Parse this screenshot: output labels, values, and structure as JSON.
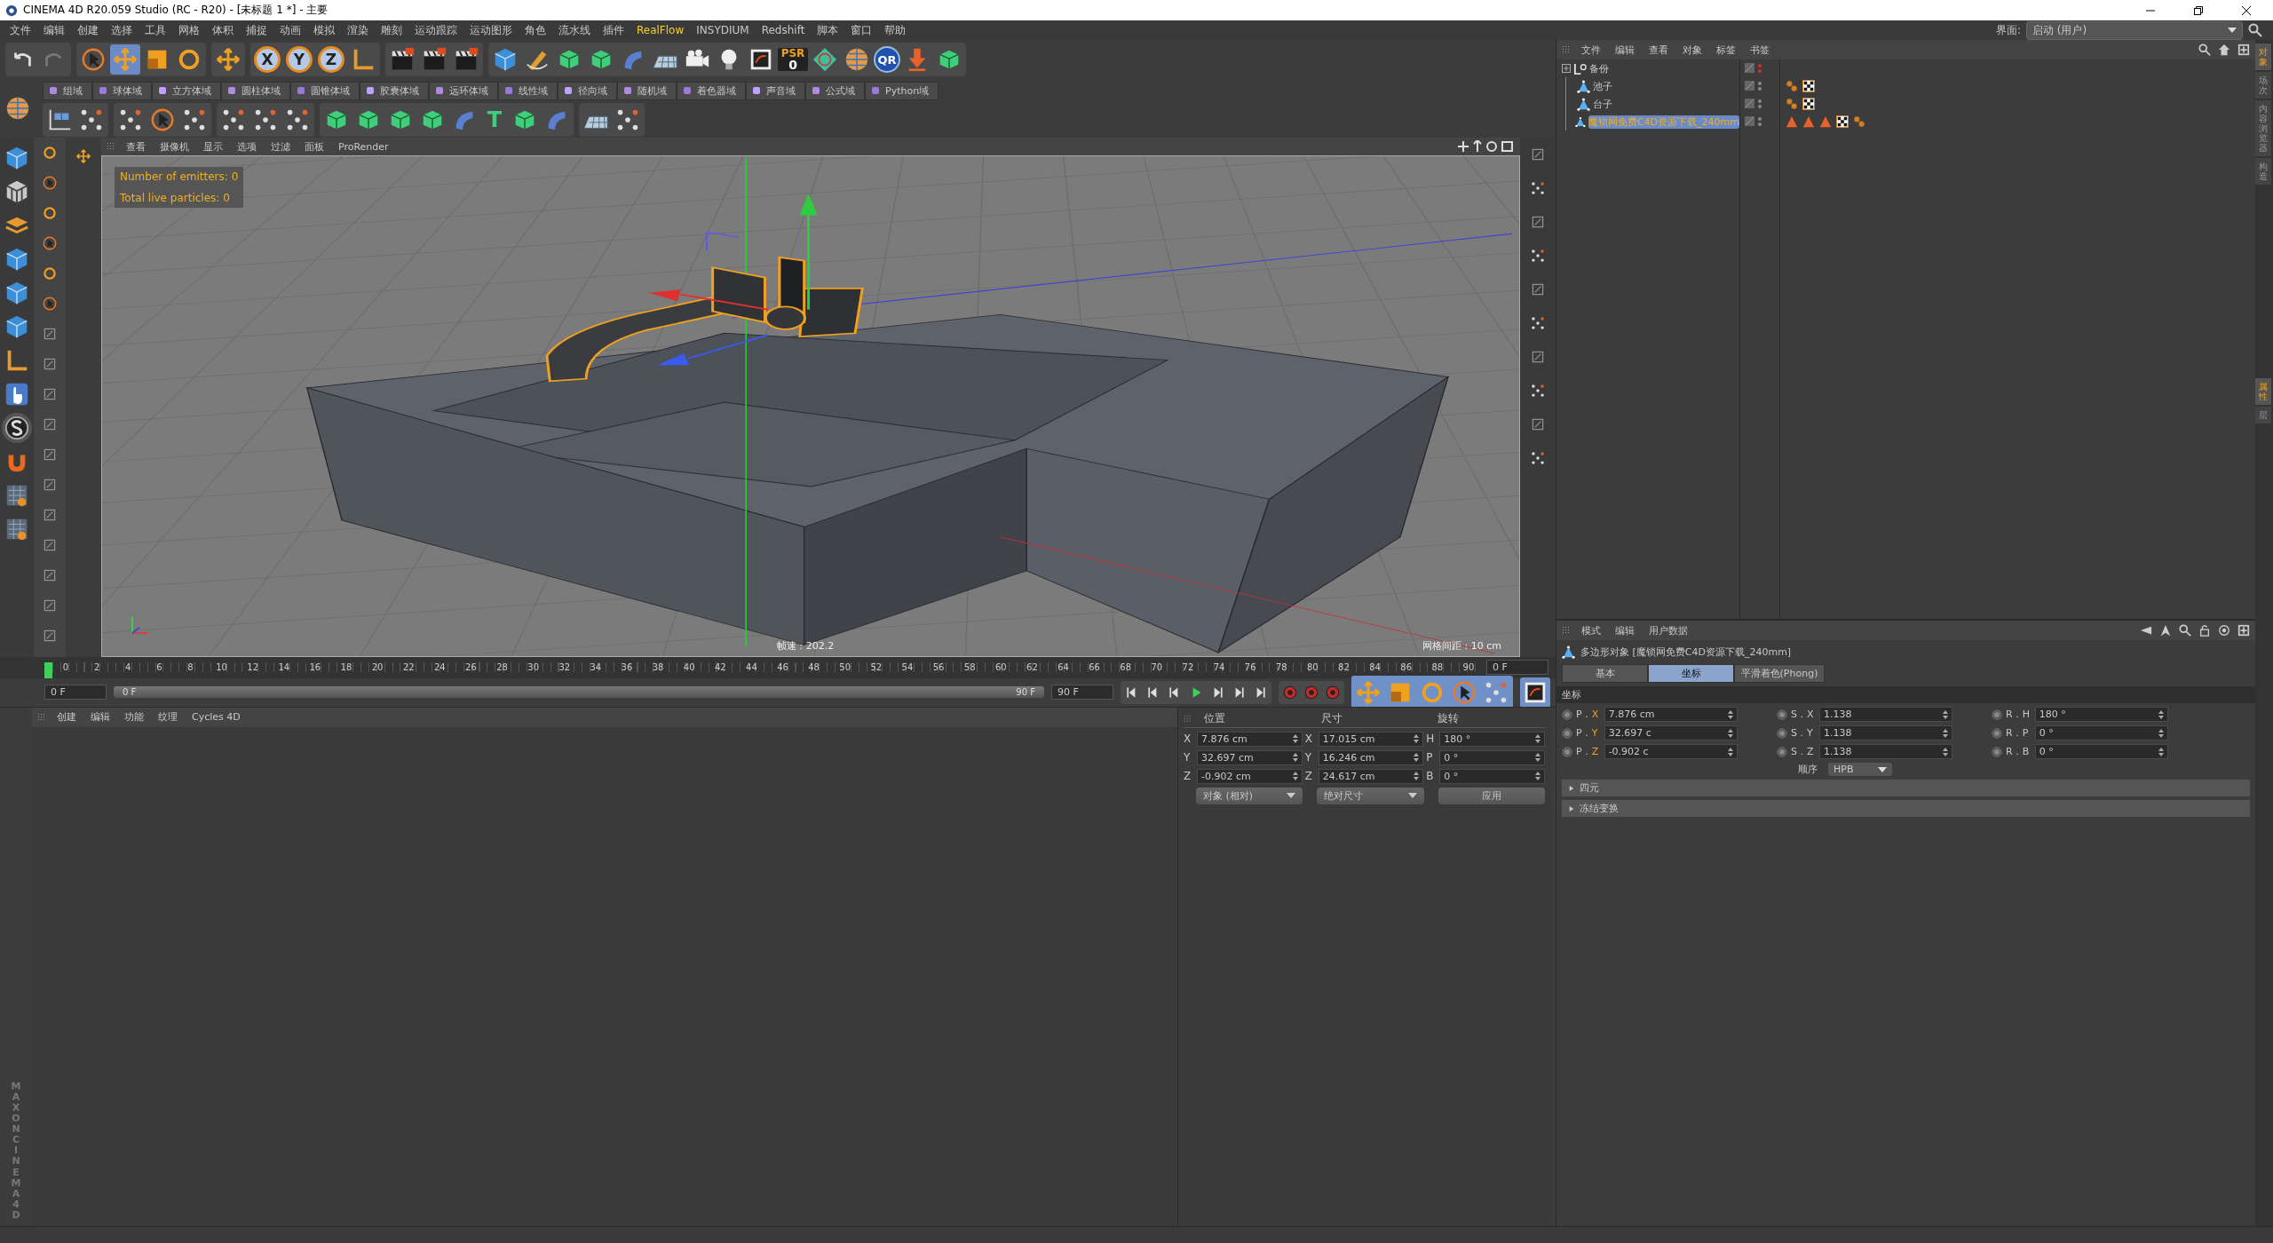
{
  "window": {
    "title": "CINEMA 4D R20.059 Studio (RC - R20) - [未标题 1 *] - 主要"
  },
  "menu": [
    {
      "label": "文件",
      "highlighted": false
    },
    {
      "label": "编辑",
      "highlighted": false
    },
    {
      "label": "创建",
      "highlighted": false
    },
    {
      "label": "选择",
      "highlighted": false
    },
    {
      "label": "工具",
      "highlighted": false
    },
    {
      "label": "网格",
      "highlighted": false
    },
    {
      "label": "体积",
      "highlighted": false
    },
    {
      "label": "捕捉",
      "highlighted": false
    },
    {
      "label": "动画",
      "highlighted": false
    },
    {
      "label": "模拟",
      "highlighted": false
    },
    {
      "label": "渲染",
      "highlighted": false
    },
    {
      "label": "雕刻",
      "highlighted": false
    },
    {
      "label": "运动跟踪",
      "highlighted": false
    },
    {
      "label": "运动图形",
      "highlighted": false
    },
    {
      "label": "角色",
      "highlighted": false
    },
    {
      "label": "流水线",
      "highlighted": false
    },
    {
      "label": "插件",
      "highlighted": false
    },
    {
      "label": "RealFlow",
      "highlighted": true
    },
    {
      "label": "INSYDIUM",
      "highlighted": false
    },
    {
      "label": "Redshift",
      "highlighted": false
    },
    {
      "label": "脚本",
      "highlighted": false
    },
    {
      "label": "窗口",
      "highlighted": false
    },
    {
      "label": "帮助",
      "highlighted": false
    }
  ],
  "layout": {
    "label": "界面:",
    "value": "启动 (用户)"
  },
  "toolbar": {
    "axis_buttons": [
      "X",
      "Y",
      "Z"
    ],
    "psr": "PSR",
    "psr_count": "0",
    "qr": "QR",
    "text_tool": "T"
  },
  "fields_bar": [
    "组域",
    "球体域",
    "立方体域",
    "圆柱体域",
    "圆锥体域",
    "胶囊体域",
    "远环体域",
    "线性域",
    "径向域",
    "随机域",
    "着色器域",
    "声音域",
    "公式域",
    "Python域"
  ],
  "viewport": {
    "menu": [
      "查看",
      "摄像机",
      "显示",
      "选项",
      "过滤",
      "面板",
      "ProRender"
    ],
    "hud": [
      "Number of emitters: 0",
      "Total live particles: 0"
    ],
    "fps": "帧速 : 202.2",
    "grid_spacing": "网格间距 : 10 cm"
  },
  "timeline": {
    "range": {
      "level": 1
    },
    "ticks": [
      "0",
      "2",
      "4",
      "6",
      "8",
      "10",
      "12",
      "14",
      "16",
      "18",
      "20",
      "22",
      "24",
      "26",
      "28",
      "30",
      "32",
      "34",
      "36",
      "38",
      "40",
      "42",
      "44",
      "46",
      "48",
      "50",
      "52",
      "54",
      "56",
      "58",
      "60",
      "62",
      "64",
      "66",
      "68",
      "70",
      "72",
      "74",
      "76",
      "78",
      "80",
      "82",
      "84",
      "86",
      "88",
      "90"
    ],
    "end_field": "0 F",
    "current_field": "0 F",
    "range_start": "0 F",
    "range_end": "90 F",
    "max_field": "90 F"
  },
  "material_manager": {
    "menu": [
      "创建",
      "编辑",
      "功能",
      "纹理",
      "Cycles 4D"
    ]
  },
  "coordinates": {
    "headers": [
      "位置",
      "尺寸",
      "旋转"
    ],
    "rows": [
      {
        "pos_axis": "X",
        "pos": "7.876 cm",
        "size_axis": "X",
        "size": "17.015 cm",
        "rot_axis": "H",
        "rot": "180 °"
      },
      {
        "pos_axis": "Y",
        "pos": "32.697 cm",
        "size_axis": "Y",
        "size": "16.246 cm",
        "rot_axis": "P",
        "rot": "0 °"
      },
      {
        "pos_axis": "Z",
        "pos": "-0.902 cm",
        "size_axis": "Z",
        "size": "24.617 cm",
        "rot_axis": "B",
        "rot": "0 °"
      }
    ],
    "mode": "对象 (相对)",
    "size_mode": "绝对尺寸",
    "apply": "应用"
  },
  "object_manager": {
    "menu": [
      "文件",
      "编辑",
      "查看",
      "对象",
      "标签",
      "书签"
    ],
    "objects": [
      {
        "name": "备份",
        "kind": "null",
        "selected": false
      },
      {
        "name": "池子",
        "kind": "polygon",
        "selected": false,
        "tags": [
          {
            "kind": "phong"
          },
          {
            "kind": "texture"
          }
        ]
      },
      {
        "name": "台子",
        "kind": "polygon",
        "selected": false,
        "tags": [
          {
            "kind": "phong"
          },
          {
            "kind": "texture"
          }
        ]
      },
      {
        "name": "魔锁网免费C4D资源下载_240mm",
        "kind": "polygon",
        "selected": true,
        "tags": [
          {
            "kind": "material"
          },
          {
            "kind": "material"
          },
          {
            "kind": "material"
          },
          {
            "kind": "texture"
          },
          {
            "kind": "phong"
          }
        ]
      }
    ]
  },
  "attributes": {
    "menu": [
      "模式",
      "编辑",
      "用户数据"
    ],
    "title": "多边形对象 [魔锁网免费C4D资源下载_240mm]",
    "tabs": [
      {
        "label": "基本",
        "selected": false
      },
      {
        "label": "坐标",
        "selected": true
      },
      {
        "label": "平滑着色(Phong)",
        "selected": false
      }
    ],
    "section": "坐标",
    "rows": [
      [
        {
          "label": "P .",
          "axis": "X",
          "value": "7.876 cm",
          "accent": true
        },
        {
          "label": "S .",
          "axis": "X",
          "value": "1.138",
          "accent": false
        },
        {
          "label": "R .",
          "axis": "H",
          "value": "180 °",
          "accent": false
        }
      ],
      [
        {
          "label": "P .",
          "axis": "Y",
          "value": "32.697 c",
          "accent": true
        },
        {
          "label": "S .",
          "axis": "Y",
          "value": "1.138",
          "accent": false
        },
        {
          "label": "R .",
          "axis": "P",
          "value": "0 °",
          "accent": false
        }
      ],
      [
        {
          "label": "P .",
          "axis": "Z",
          "value": "-0.902 c",
          "accent": true
        },
        {
          "label": "S .",
          "axis": "Z",
          "value": "1.138",
          "accent": false
        },
        {
          "label": "R .",
          "axis": "B",
          "value": "0 °",
          "accent": false
        }
      ]
    ],
    "order_label": "顺序",
    "order": "HPB",
    "groups": [
      {
        "label": "四元",
        "expanded": false
      },
      {
        "label": "冻结变换",
        "expanded": false
      }
    ]
  },
  "side_tabs_top": [
    {
      "label": "对象",
      "selected": true
    },
    {
      "label": "场次",
      "selected": false
    },
    {
      "label": "内容浏览器",
      "selected": false
    },
    {
      "label": "构造",
      "selected": false
    }
  ],
  "side_tabs_bottom": [
    {
      "label": "属性",
      "selected": true
    },
    {
      "label": "层",
      "selected": false
    }
  ],
  "logo": [
    "MAXON",
    "CINEMA 4D"
  ]
}
